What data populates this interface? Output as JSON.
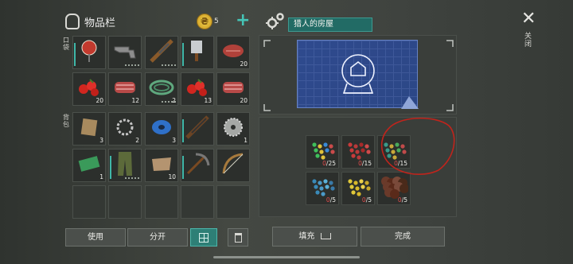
{
  "inventory": {
    "title": "物品栏",
    "coins": "5",
    "coin_symbol": "₴",
    "hotbar_label": "口袋",
    "backpack_label": "背包",
    "row1": [
      {
        "name": "stop-sign",
        "count": ""
      },
      {
        "name": "revolver",
        "count": ""
      },
      {
        "name": "rifle",
        "count": ""
      },
      {
        "name": "cleaver",
        "count": ""
      },
      {
        "name": "raw-steak",
        "count": "20"
      }
    ],
    "row2": [
      {
        "name": "berries",
        "count": "20"
      },
      {
        "name": "raw-meat",
        "count": "12"
      },
      {
        "name": "rope-coil",
        "count": "2"
      },
      {
        "name": "berries",
        "count": "13"
      },
      {
        "name": "raw-meat",
        "count": "20"
      }
    ],
    "row3": [
      {
        "name": "fiber",
        "count": "3"
      },
      {
        "name": "chain",
        "count": "2"
      },
      {
        "name": "tape",
        "count": "3"
      },
      {
        "name": "shotgun",
        "count": ""
      },
      {
        "name": "saw-blade",
        "count": "1"
      }
    ],
    "row4": [
      {
        "name": "ticket",
        "count": "1"
      },
      {
        "name": "pants",
        "count": ""
      },
      {
        "name": "leather",
        "count": "10"
      },
      {
        "name": "pickaxe",
        "count": ""
      },
      {
        "name": "bow",
        "count": ""
      }
    ]
  },
  "buttons": {
    "use": "使用",
    "split": "分开",
    "fill": "填充",
    "done": "完成"
  },
  "recipe": {
    "title": "猎人的房屋",
    "slots": [
      {
        "zero": "0",
        "total": "/25"
      },
      {
        "zero": "0",
        "total": "/15"
      },
      {
        "zero": "0",
        "total": "/15"
      },
      {
        "zero": "0",
        "total": "/5"
      },
      {
        "zero": "0",
        "total": "/5"
      },
      {
        "zero": "0",
        "total": "/5"
      }
    ]
  },
  "close_label": "关闭",
  "colors": {
    "accent": "#45c4b6",
    "annotation": "#c0241c"
  }
}
